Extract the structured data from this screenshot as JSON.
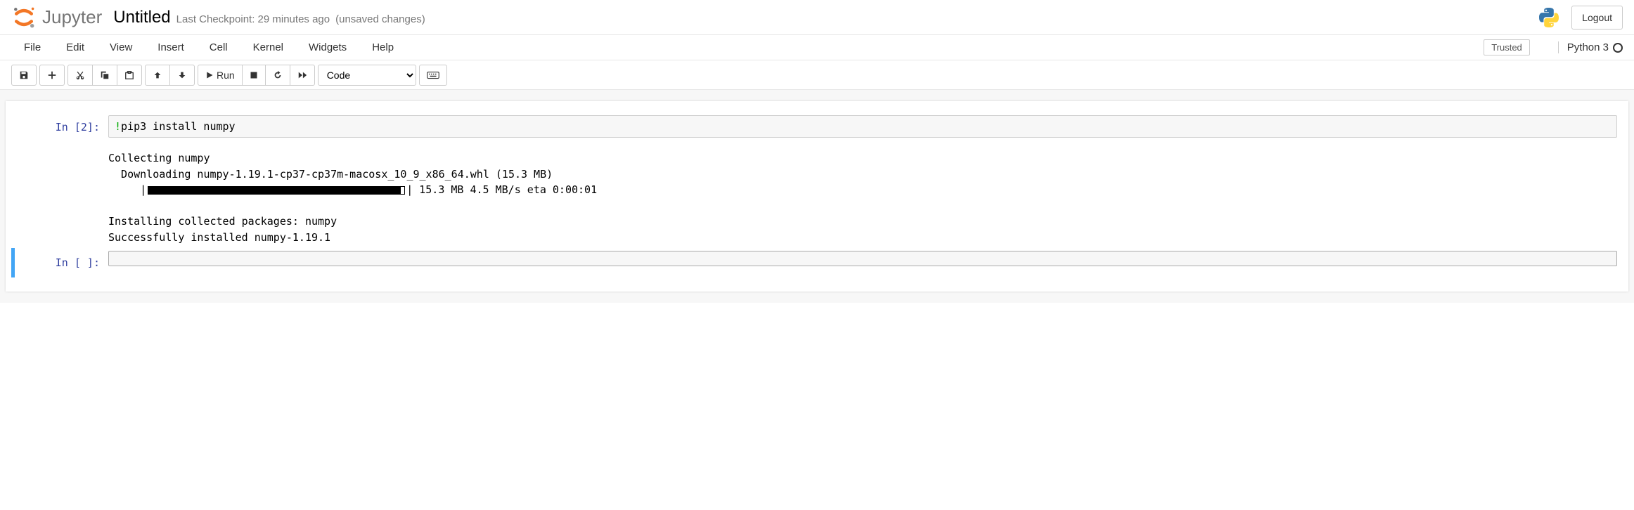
{
  "header": {
    "logo_text": "Jupyter",
    "title": "Untitled",
    "checkpoint": "Last Checkpoint: 29 minutes ago",
    "unsaved": "(unsaved changes)",
    "logout": "Logout"
  },
  "menubar": {
    "items": [
      "File",
      "Edit",
      "View",
      "Insert",
      "Cell",
      "Kernel",
      "Widgets",
      "Help"
    ],
    "trusted": "Trusted",
    "kernel": "Python 3"
  },
  "toolbar": {
    "run_label": "Run",
    "cell_type": "Code"
  },
  "cells": [
    {
      "prompt": "In [2]:",
      "input_bang": "!",
      "input_rest": "pip3 install numpy",
      "output": {
        "line1": "Collecting numpy",
        "line2": "  Downloading numpy-1.19.1-cp37-cp37m-macosx_10_9_x86_64.whl (15.3 MB)",
        "progress_prefix": "     |",
        "progress_suffix": "| 15.3 MB 4.5 MB/s eta 0:00:01",
        "line4": "Installing collected packages: numpy",
        "line5": "Successfully installed numpy-1.19.1"
      }
    },
    {
      "prompt": "In [ ]:",
      "input": ""
    }
  ]
}
